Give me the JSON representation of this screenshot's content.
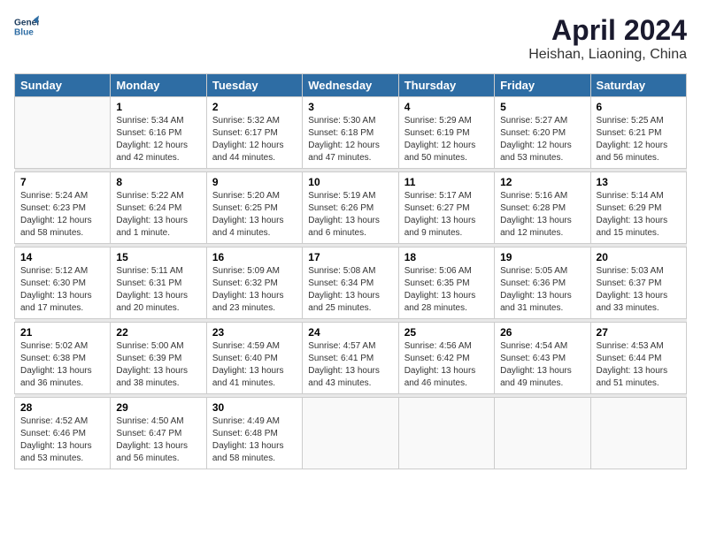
{
  "header": {
    "logo_line1": "General",
    "logo_line2": "Blue",
    "month_year": "April 2024",
    "location": "Heishan, Liaoning, China"
  },
  "days_of_week": [
    "Sunday",
    "Monday",
    "Tuesday",
    "Wednesday",
    "Thursday",
    "Friday",
    "Saturday"
  ],
  "weeks": [
    [
      {
        "day": "",
        "sunrise": "",
        "sunset": "",
        "daylight": ""
      },
      {
        "day": "1",
        "sunrise": "Sunrise: 5:34 AM",
        "sunset": "Sunset: 6:16 PM",
        "daylight": "Daylight: 12 hours and 42 minutes."
      },
      {
        "day": "2",
        "sunrise": "Sunrise: 5:32 AM",
        "sunset": "Sunset: 6:17 PM",
        "daylight": "Daylight: 12 hours and 44 minutes."
      },
      {
        "day": "3",
        "sunrise": "Sunrise: 5:30 AM",
        "sunset": "Sunset: 6:18 PM",
        "daylight": "Daylight: 12 hours and 47 minutes."
      },
      {
        "day": "4",
        "sunrise": "Sunrise: 5:29 AM",
        "sunset": "Sunset: 6:19 PM",
        "daylight": "Daylight: 12 hours and 50 minutes."
      },
      {
        "day": "5",
        "sunrise": "Sunrise: 5:27 AM",
        "sunset": "Sunset: 6:20 PM",
        "daylight": "Daylight: 12 hours and 53 minutes."
      },
      {
        "day": "6",
        "sunrise": "Sunrise: 5:25 AM",
        "sunset": "Sunset: 6:21 PM",
        "daylight": "Daylight: 12 hours and 56 minutes."
      }
    ],
    [
      {
        "day": "7",
        "sunrise": "Sunrise: 5:24 AM",
        "sunset": "Sunset: 6:23 PM",
        "daylight": "Daylight: 12 hours and 58 minutes."
      },
      {
        "day": "8",
        "sunrise": "Sunrise: 5:22 AM",
        "sunset": "Sunset: 6:24 PM",
        "daylight": "Daylight: 13 hours and 1 minute."
      },
      {
        "day": "9",
        "sunrise": "Sunrise: 5:20 AM",
        "sunset": "Sunset: 6:25 PM",
        "daylight": "Daylight: 13 hours and 4 minutes."
      },
      {
        "day": "10",
        "sunrise": "Sunrise: 5:19 AM",
        "sunset": "Sunset: 6:26 PM",
        "daylight": "Daylight: 13 hours and 6 minutes."
      },
      {
        "day": "11",
        "sunrise": "Sunrise: 5:17 AM",
        "sunset": "Sunset: 6:27 PM",
        "daylight": "Daylight: 13 hours and 9 minutes."
      },
      {
        "day": "12",
        "sunrise": "Sunrise: 5:16 AM",
        "sunset": "Sunset: 6:28 PM",
        "daylight": "Daylight: 13 hours and 12 minutes."
      },
      {
        "day": "13",
        "sunrise": "Sunrise: 5:14 AM",
        "sunset": "Sunset: 6:29 PM",
        "daylight": "Daylight: 13 hours and 15 minutes."
      }
    ],
    [
      {
        "day": "14",
        "sunrise": "Sunrise: 5:12 AM",
        "sunset": "Sunset: 6:30 PM",
        "daylight": "Daylight: 13 hours and 17 minutes."
      },
      {
        "day": "15",
        "sunrise": "Sunrise: 5:11 AM",
        "sunset": "Sunset: 6:31 PM",
        "daylight": "Daylight: 13 hours and 20 minutes."
      },
      {
        "day": "16",
        "sunrise": "Sunrise: 5:09 AM",
        "sunset": "Sunset: 6:32 PM",
        "daylight": "Daylight: 13 hours and 23 minutes."
      },
      {
        "day": "17",
        "sunrise": "Sunrise: 5:08 AM",
        "sunset": "Sunset: 6:34 PM",
        "daylight": "Daylight: 13 hours and 25 minutes."
      },
      {
        "day": "18",
        "sunrise": "Sunrise: 5:06 AM",
        "sunset": "Sunset: 6:35 PM",
        "daylight": "Daylight: 13 hours and 28 minutes."
      },
      {
        "day": "19",
        "sunrise": "Sunrise: 5:05 AM",
        "sunset": "Sunset: 6:36 PM",
        "daylight": "Daylight: 13 hours and 31 minutes."
      },
      {
        "day": "20",
        "sunrise": "Sunrise: 5:03 AM",
        "sunset": "Sunset: 6:37 PM",
        "daylight": "Daylight: 13 hours and 33 minutes."
      }
    ],
    [
      {
        "day": "21",
        "sunrise": "Sunrise: 5:02 AM",
        "sunset": "Sunset: 6:38 PM",
        "daylight": "Daylight: 13 hours and 36 minutes."
      },
      {
        "day": "22",
        "sunrise": "Sunrise: 5:00 AM",
        "sunset": "Sunset: 6:39 PM",
        "daylight": "Daylight: 13 hours and 38 minutes."
      },
      {
        "day": "23",
        "sunrise": "Sunrise: 4:59 AM",
        "sunset": "Sunset: 6:40 PM",
        "daylight": "Daylight: 13 hours and 41 minutes."
      },
      {
        "day": "24",
        "sunrise": "Sunrise: 4:57 AM",
        "sunset": "Sunset: 6:41 PM",
        "daylight": "Daylight: 13 hours and 43 minutes."
      },
      {
        "day": "25",
        "sunrise": "Sunrise: 4:56 AM",
        "sunset": "Sunset: 6:42 PM",
        "daylight": "Daylight: 13 hours and 46 minutes."
      },
      {
        "day": "26",
        "sunrise": "Sunrise: 4:54 AM",
        "sunset": "Sunset: 6:43 PM",
        "daylight": "Daylight: 13 hours and 49 minutes."
      },
      {
        "day": "27",
        "sunrise": "Sunrise: 4:53 AM",
        "sunset": "Sunset: 6:44 PM",
        "daylight": "Daylight: 13 hours and 51 minutes."
      }
    ],
    [
      {
        "day": "28",
        "sunrise": "Sunrise: 4:52 AM",
        "sunset": "Sunset: 6:46 PM",
        "daylight": "Daylight: 13 hours and 53 minutes."
      },
      {
        "day": "29",
        "sunrise": "Sunrise: 4:50 AM",
        "sunset": "Sunset: 6:47 PM",
        "daylight": "Daylight: 13 hours and 56 minutes."
      },
      {
        "day": "30",
        "sunrise": "Sunrise: 4:49 AM",
        "sunset": "Sunset: 6:48 PM",
        "daylight": "Daylight: 13 hours and 58 minutes."
      },
      {
        "day": "",
        "sunrise": "",
        "sunset": "",
        "daylight": ""
      },
      {
        "day": "",
        "sunrise": "",
        "sunset": "",
        "daylight": ""
      },
      {
        "day": "",
        "sunrise": "",
        "sunset": "",
        "daylight": ""
      },
      {
        "day": "",
        "sunrise": "",
        "sunset": "",
        "daylight": ""
      }
    ]
  ]
}
